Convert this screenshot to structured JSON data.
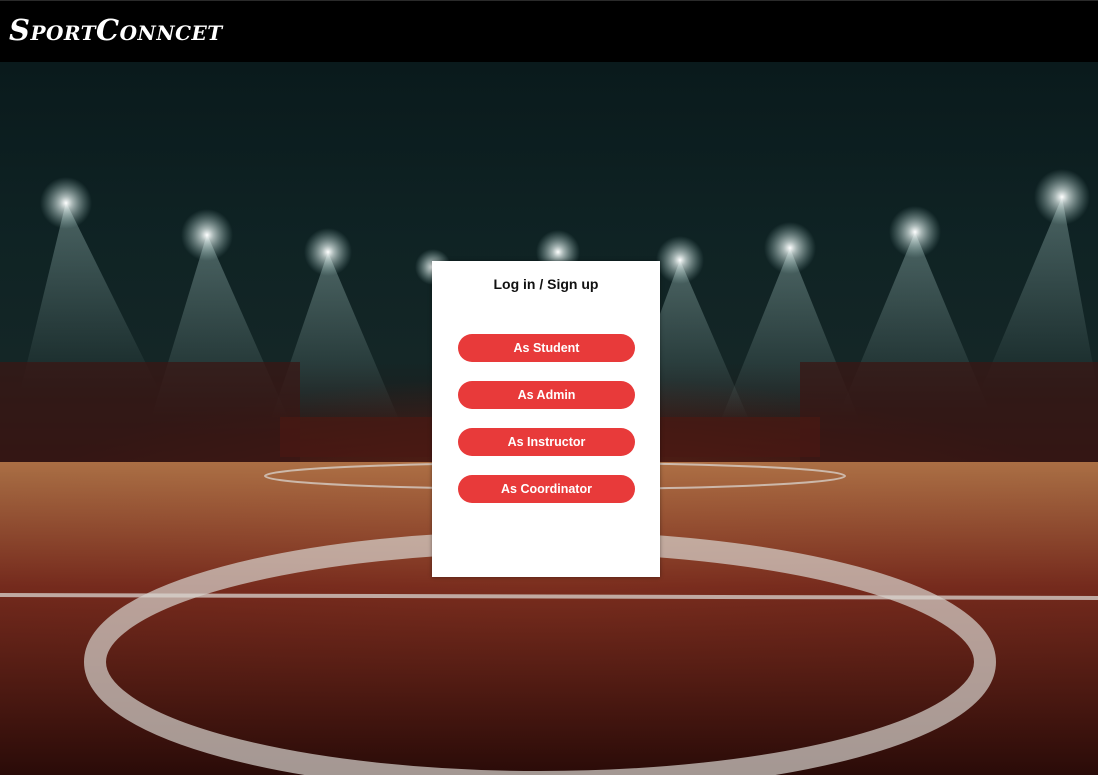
{
  "header": {
    "brand": "SportConncet"
  },
  "login_modal": {
    "title": "Log in / Sign up",
    "buttons": [
      {
        "label": "As Student"
      },
      {
        "label": "As Admin"
      },
      {
        "label": "As Instructor"
      },
      {
        "label": "As Coordinator"
      }
    ]
  },
  "colors": {
    "accent": "#e83a3a",
    "header_bg": "#000000",
    "modal_bg": "#ffffff"
  }
}
